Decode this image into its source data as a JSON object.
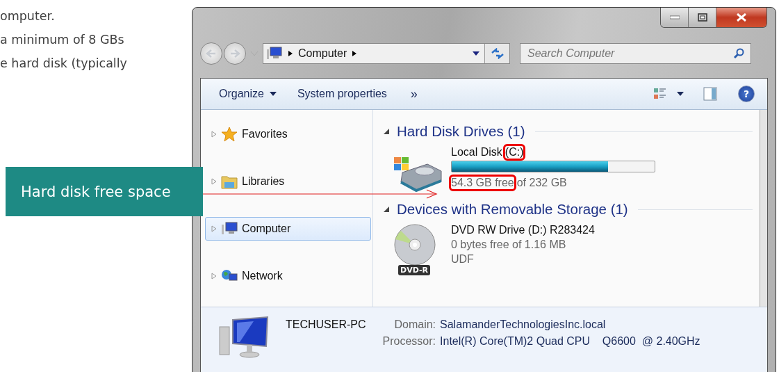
{
  "document_text": [
    "omputer.",
    "a minimum of 8 GBs",
    "e hard disk (typically"
  ],
  "callout": {
    "label": "Hard disk free space"
  },
  "window": {
    "address": {
      "crumbs": [
        "Computer"
      ]
    },
    "search": {
      "placeholder": "Search Computer"
    },
    "toolbar": {
      "items": [
        {
          "label": "Organize",
          "dropdown": true
        },
        {
          "label": "System properties",
          "dropdown": false
        }
      ],
      "more": "»",
      "help": "?"
    },
    "sidebar": {
      "items": [
        {
          "label": "Favorites",
          "selected": false
        },
        {
          "label": "Libraries",
          "selected": false
        },
        {
          "label": "Computer",
          "selected": true
        },
        {
          "label": "Network",
          "selected": false
        }
      ]
    },
    "groups": [
      {
        "title": "Hard Disk Drives (1)",
        "expanded": true,
        "items": [
          {
            "kind": "disk",
            "name": "Local Disk",
            "letter": "(C:)",
            "letter_highlighted": true,
            "level": 0.77,
            "free": "54.3 GB free",
            "free_highlighted": true,
            "total": "of 232 GB"
          }
        ]
      },
      {
        "title": "Devices with Removable Storage (1)",
        "expanded": true,
        "items": [
          {
            "kind": "optical",
            "name": "DVD RW Drive (D:) R283424",
            "badge": "DVD-R",
            "lines": [
              "0 bytes free of 1.16 MB",
              "UDF"
            ]
          }
        ]
      }
    ],
    "details": {
      "name": "TECHUSER-PC",
      "fields": [
        {
          "label": "Domain:",
          "value": "SalamanderTechnologiesInc.local"
        },
        {
          "label": "Processor:",
          "value": "Intel(R) Core(TM)2 Quad CPU    Q6600  @ 2.40GHz"
        }
      ]
    }
  }
}
